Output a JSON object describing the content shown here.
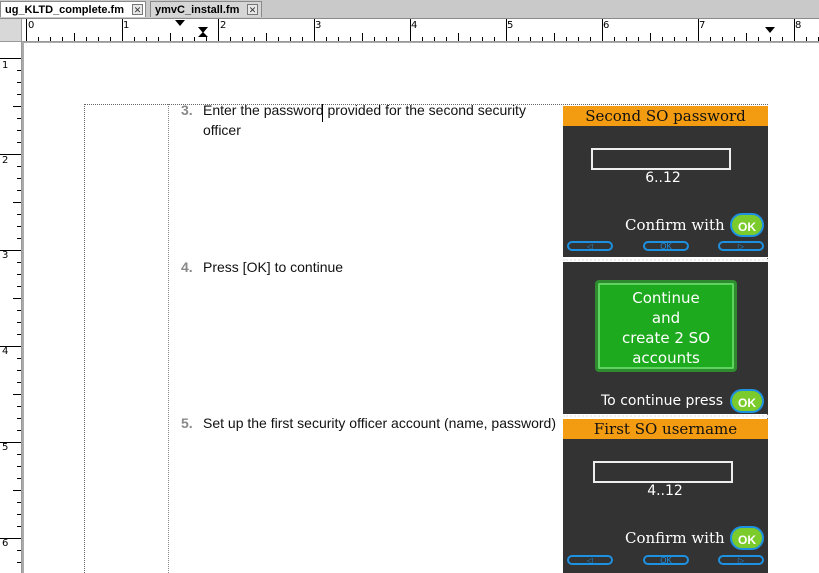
{
  "tabs": [
    {
      "label": "ug_KLTD_complete.fm",
      "close": "✕"
    },
    {
      "label": "ymvC_install.fm",
      "close": "✕"
    }
  ],
  "ruler": {
    "h": [
      "0",
      "1",
      "2",
      "3",
      "4",
      "5",
      "6",
      "7",
      "8"
    ],
    "v": [
      "1",
      "2",
      "3",
      "4",
      "5",
      "6"
    ]
  },
  "steps": [
    {
      "num": "3.",
      "text": "Enter the password provided for the second security officer"
    },
    {
      "num": "4.",
      "text": "Press [OK] to continue"
    },
    {
      "num": "5.",
      "text": "Set up the first security officer account (name, password)"
    }
  ],
  "screen1": {
    "title": "Second SO password",
    "range": "6..12",
    "confirm": "Confirm with",
    "ok": "OK",
    "left": "◁",
    "mid": "OK",
    "right": "▷"
  },
  "screen2": {
    "line1": "Continue",
    "line2": "and",
    "line3": "create 2 SO",
    "line4": "accounts",
    "confirm": "To continue press",
    "ok": "OK"
  },
  "screen3": {
    "title": "First SO username",
    "range": "4..12",
    "confirm": "Confirm with",
    "ok": "OK",
    "left": "◁",
    "mid": "OK",
    "right": "▷"
  }
}
